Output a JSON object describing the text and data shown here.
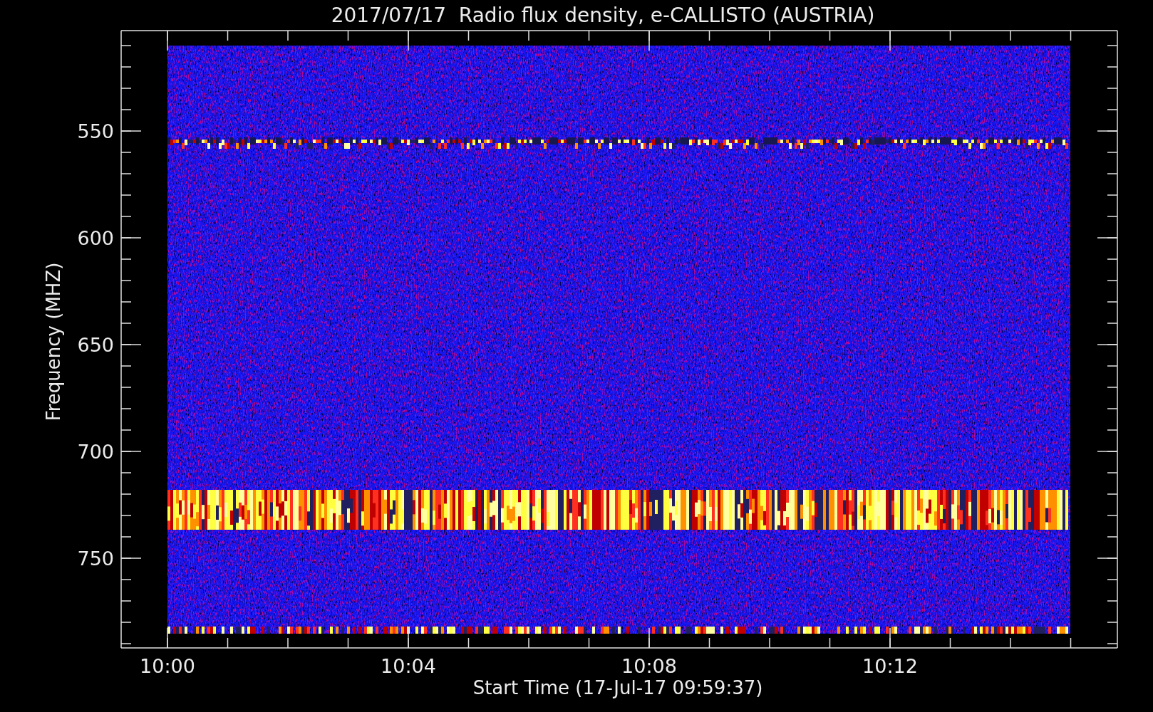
{
  "title": "2017/07/17  Radio flux density, e-CALLISTO (AUSTRIA)",
  "y_axis": {
    "label": "Frequency (MHZ)",
    "ticks": [
      "550",
      "600",
      "650",
      "700",
      "750"
    ]
  },
  "x_axis": {
    "label": "Start Time (17-Jul-17 09:59:37)",
    "ticks": [
      "10:00",
      "10:04",
      "10:08",
      "10:12"
    ]
  }
}
